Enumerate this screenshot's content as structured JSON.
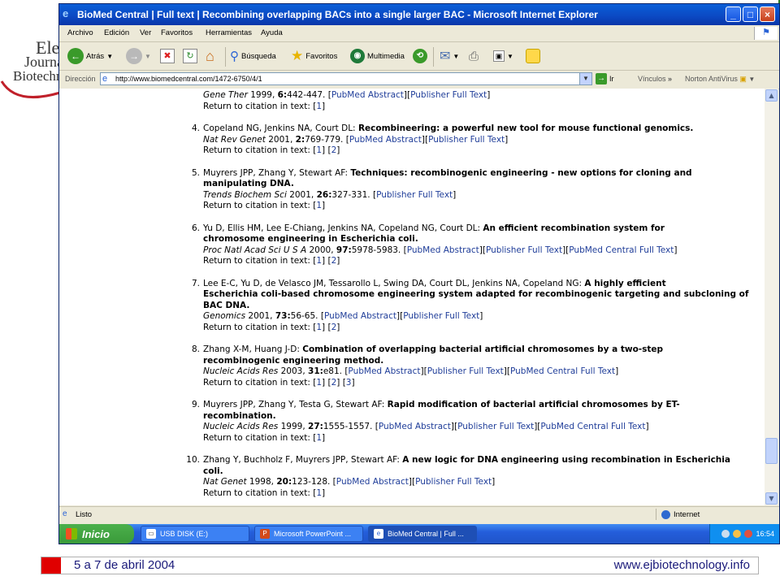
{
  "background_logo": {
    "line1": "Elec",
    "line2": "Journal",
    "line3": "Biotechnol"
  },
  "window": {
    "title": "BioMed Central | Full text | Recombining overlapping BACs into a single larger BAC - Microsoft Internet Explorer",
    "buttons": {
      "minimize": "_",
      "maximize": "□",
      "close": "×"
    }
  },
  "menu": [
    "Archivo",
    "Edición",
    "Ver",
    "Favoritos",
    "Herramientas",
    "Ayuda"
  ],
  "toolbar": {
    "back": "Atrás",
    "search": "Búsqueda",
    "favorites": "Favoritos",
    "multimedia": "Multimedia"
  },
  "address": {
    "label": "Dirección",
    "url": "http://www.biomedcentral.com/1472-6750/4/1",
    "go": "Ir",
    "links": "Vínculos",
    "norton": "Norton AntiVirus"
  },
  "references": [
    {
      "num": "",
      "lines": [
        [
          {
            "t": "Gene Ther",
            "s": "j"
          },
          {
            "t": " 1999, "
          },
          {
            "t": "6:",
            "s": "v"
          },
          {
            "t": "442-447. ["
          },
          {
            "t": "PubMed Abstract",
            "s": "l"
          },
          {
            "t": "]["
          },
          {
            "t": "Publisher Full Text",
            "s": "l"
          },
          {
            "t": "]"
          }
        ],
        [
          {
            "t": "Return to citation in text: ["
          },
          {
            "t": "1",
            "s": "l"
          },
          {
            "t": "]"
          }
        ]
      ]
    },
    {
      "num": "4.",
      "lines": [
        [
          {
            "t": "Copeland NG, Jenkins NA, Court DL: "
          },
          {
            "t": "Recombineering: a powerful new tool for mouse functional genomics.",
            "s": "t"
          }
        ],
        [
          {
            "t": "Nat Rev Genet",
            "s": "j"
          },
          {
            "t": " 2001, "
          },
          {
            "t": "2:",
            "s": "v"
          },
          {
            "t": "769-779. ["
          },
          {
            "t": "PubMed Abstract",
            "s": "l"
          },
          {
            "t": "]["
          },
          {
            "t": "Publisher Full Text",
            "s": "l"
          },
          {
            "t": "]"
          }
        ],
        [
          {
            "t": "Return to citation in text: ["
          },
          {
            "t": "1",
            "s": "l"
          },
          {
            "t": "] ["
          },
          {
            "t": "2",
            "s": "l"
          },
          {
            "t": "]"
          }
        ]
      ]
    },
    {
      "num": "5.",
      "lines": [
        [
          {
            "t": "Muyrers JPP, Zhang Y, Stewart AF: "
          },
          {
            "t": "Techniques: recombinogenic engineering - new options for cloning and",
            "s": "t"
          }
        ],
        [
          {
            "t": "manipulating DNA.",
            "s": "t"
          }
        ],
        [
          {
            "t": "Trends Biochem Sci",
            "s": "j"
          },
          {
            "t": " 2001, "
          },
          {
            "t": "26:",
            "s": "v"
          },
          {
            "t": "327-331. ["
          },
          {
            "t": "Publisher Full Text",
            "s": "l"
          },
          {
            "t": "]"
          }
        ],
        [
          {
            "t": "Return to citation in text: ["
          },
          {
            "t": "1",
            "s": "l"
          },
          {
            "t": "]"
          }
        ]
      ]
    },
    {
      "num": "6.",
      "lines": [
        [
          {
            "t": "Yu D, Ellis HM, Lee E-Chiang, Jenkins NA, Copeland NG, Court DL: "
          },
          {
            "t": "An efficient recombination system for",
            "s": "t"
          }
        ],
        [
          {
            "t": "chromosome engineering in Escherichia coli.",
            "s": "t"
          }
        ],
        [
          {
            "t": "Proc Natl Acad Sci U S A",
            "s": "j"
          },
          {
            "t": " 2000, "
          },
          {
            "t": "97:",
            "s": "v"
          },
          {
            "t": "5978-5983. ["
          },
          {
            "t": "PubMed Abstract",
            "s": "l"
          },
          {
            "t": "]["
          },
          {
            "t": "Publisher Full Text",
            "s": "l"
          },
          {
            "t": "]["
          },
          {
            "t": "PubMed Central Full Text",
            "s": "l"
          },
          {
            "t": "]"
          }
        ],
        [
          {
            "t": "Return to citation in text: ["
          },
          {
            "t": "1",
            "s": "l"
          },
          {
            "t": "] ["
          },
          {
            "t": "2",
            "s": "l"
          },
          {
            "t": "]"
          }
        ]
      ]
    },
    {
      "num": "7.",
      "lines": [
        [
          {
            "t": "Lee E-C, Yu D, de Velasco JM, Tessarollo L, Swing DA, Court DL, Jenkins NA, Copeland NG: "
          },
          {
            "t": "A highly efficient",
            "s": "t"
          }
        ],
        [
          {
            "t": "Escherichia coli-based chromosome engineering system adapted for recombinogenic targeting and subcloning of",
            "s": "t"
          }
        ],
        [
          {
            "t": "BAC DNA.",
            "s": "t"
          }
        ],
        [
          {
            "t": "Genomics",
            "s": "j"
          },
          {
            "t": " 2001, "
          },
          {
            "t": "73:",
            "s": "v"
          },
          {
            "t": "56-65. ["
          },
          {
            "t": "PubMed Abstract",
            "s": "l"
          },
          {
            "t": "]["
          },
          {
            "t": "Publisher Full Text",
            "s": "l"
          },
          {
            "t": "]"
          }
        ],
        [
          {
            "t": "Return to citation in text: ["
          },
          {
            "t": "1",
            "s": "l"
          },
          {
            "t": "] ["
          },
          {
            "t": "2",
            "s": "l"
          },
          {
            "t": "]"
          }
        ]
      ]
    },
    {
      "num": "8.",
      "lines": [
        [
          {
            "t": "Zhang X-M, Huang J-D: "
          },
          {
            "t": "Combination of overlapping bacterial artificial chromosomes by a two-step",
            "s": "t"
          }
        ],
        [
          {
            "t": "recombinogenic engineering method.",
            "s": "t"
          }
        ],
        [
          {
            "t": "Nucleic Acids Res",
            "s": "j"
          },
          {
            "t": " 2003, "
          },
          {
            "t": "31:",
            "s": "v"
          },
          {
            "t": "e81. ["
          },
          {
            "t": "PubMed Abstract",
            "s": "l"
          },
          {
            "t": "]["
          },
          {
            "t": "Publisher Full Text",
            "s": "l"
          },
          {
            "t": "]["
          },
          {
            "t": "PubMed Central Full Text",
            "s": "l"
          },
          {
            "t": "]"
          }
        ],
        [
          {
            "t": "Return to citation in text: ["
          },
          {
            "t": "1",
            "s": "l"
          },
          {
            "t": "] ["
          },
          {
            "t": "2",
            "s": "l"
          },
          {
            "t": "] ["
          },
          {
            "t": "3",
            "s": "l"
          },
          {
            "t": "]"
          }
        ]
      ]
    },
    {
      "num": "9.",
      "lines": [
        [
          {
            "t": "Muyrers JPP, Zhang Y, Testa G, Stewart AF: "
          },
          {
            "t": "Rapid modification of bacterial artificial chromosomes by ET-",
            "s": "t"
          }
        ],
        [
          {
            "t": "recombination.",
            "s": "t"
          }
        ],
        [
          {
            "t": "Nucleic Acids Res",
            "s": "j"
          },
          {
            "t": " 1999, "
          },
          {
            "t": "27:",
            "s": "v"
          },
          {
            "t": "1555-1557. ["
          },
          {
            "t": "PubMed Abstract",
            "s": "l"
          },
          {
            "t": "]["
          },
          {
            "t": "Publisher Full Text",
            "s": "l"
          },
          {
            "t": "]["
          },
          {
            "t": "PubMed Central Full Text",
            "s": "l"
          },
          {
            "t": "]"
          }
        ],
        [
          {
            "t": "Return to citation in text: ["
          },
          {
            "t": "1",
            "s": "l"
          },
          {
            "t": "]"
          }
        ]
      ]
    },
    {
      "num": "10.",
      "lines": [
        [
          {
            "t": "Zhang Y, Buchholz F, Muyrers JPP, Stewart AF: "
          },
          {
            "t": "A new logic for DNA engineering using recombination in Escherichia",
            "s": "t"
          }
        ],
        [
          {
            "t": "coli.",
            "s": "t"
          }
        ],
        [
          {
            "t": "Nat Genet",
            "s": "j"
          },
          {
            "t": " 1998, "
          },
          {
            "t": "20:",
            "s": "v"
          },
          {
            "t": "123-128. ["
          },
          {
            "t": "PubMed Abstract",
            "s": "l"
          },
          {
            "t": "]["
          },
          {
            "t": "Publisher Full Text",
            "s": "l"
          },
          {
            "t": "]"
          }
        ],
        [
          {
            "t": "Return to citation in text: ["
          },
          {
            "t": "1",
            "s": "l"
          },
          {
            "t": "]"
          }
        ]
      ]
    }
  ],
  "status": {
    "text": "Listo",
    "zone": "Internet"
  },
  "taskbar": {
    "start": "Inicio",
    "tasks": [
      "USB DISK (E:)",
      "Microsoft PowerPoint ...",
      "BioMed Central | Full ..."
    ],
    "clock": "16:54"
  },
  "footer": {
    "date": "5 a 7 de abril 2004",
    "website": "www.ejbiotechnology.info"
  },
  "colors": {
    "link": "#1f3d99",
    "titlebar": "#0b48c2",
    "footer_accent": "#e00000",
    "footer_text": "#1a1a7a"
  }
}
